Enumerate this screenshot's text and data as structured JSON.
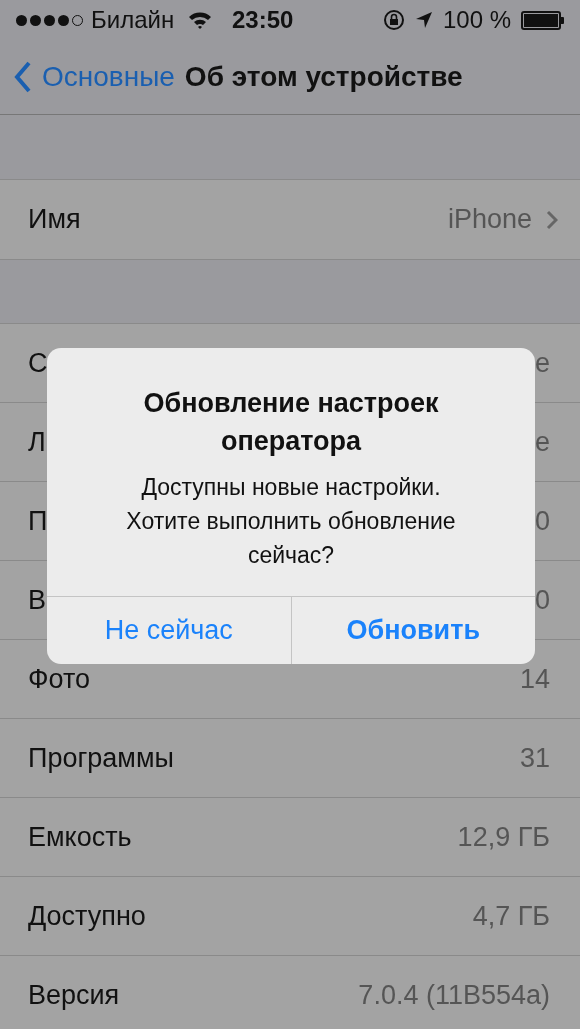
{
  "status_bar": {
    "signal_dots": [
      {
        "filled": true
      },
      {
        "filled": true
      },
      {
        "filled": true
      },
      {
        "filled": true
      },
      {
        "filled": false
      }
    ],
    "carrier": "Билайн",
    "time": "23:50",
    "battery_text": "100 %"
  },
  "nav": {
    "back": "Основные",
    "title": "Об этом устройстве"
  },
  "sections": [
    {
      "rows": [
        {
          "label": "Имя",
          "value": "iPhone",
          "chevron": true
        }
      ]
    },
    {
      "rows": [
        {
          "label": "С",
          "value": "е",
          "chevron": false
        },
        {
          "label": "Л",
          "value": "е",
          "chevron": false
        },
        {
          "label": "П",
          "value": "0",
          "chevron": false
        },
        {
          "label": "В",
          "value": "0",
          "chevron": false
        },
        {
          "label": "Фото",
          "value": "14",
          "chevron": false
        },
        {
          "label": "Программы",
          "value": "31",
          "chevron": false
        },
        {
          "label": "Емкость",
          "value": "12,9 ГБ",
          "chevron": false
        },
        {
          "label": "Доступно",
          "value": "4,7 ГБ",
          "chevron": false
        },
        {
          "label": "Версия",
          "value": "7.0.4 (11B554a)",
          "chevron": false
        }
      ]
    }
  ],
  "alert": {
    "title": "Обновление настроек оператора",
    "message": "Доступны новые настройки. Хотите выполнить обновление сейчас?",
    "buttons": [
      {
        "label": "Не сейчас",
        "kind": "cancel"
      },
      {
        "label": "Обновить",
        "kind": "default"
      }
    ]
  }
}
